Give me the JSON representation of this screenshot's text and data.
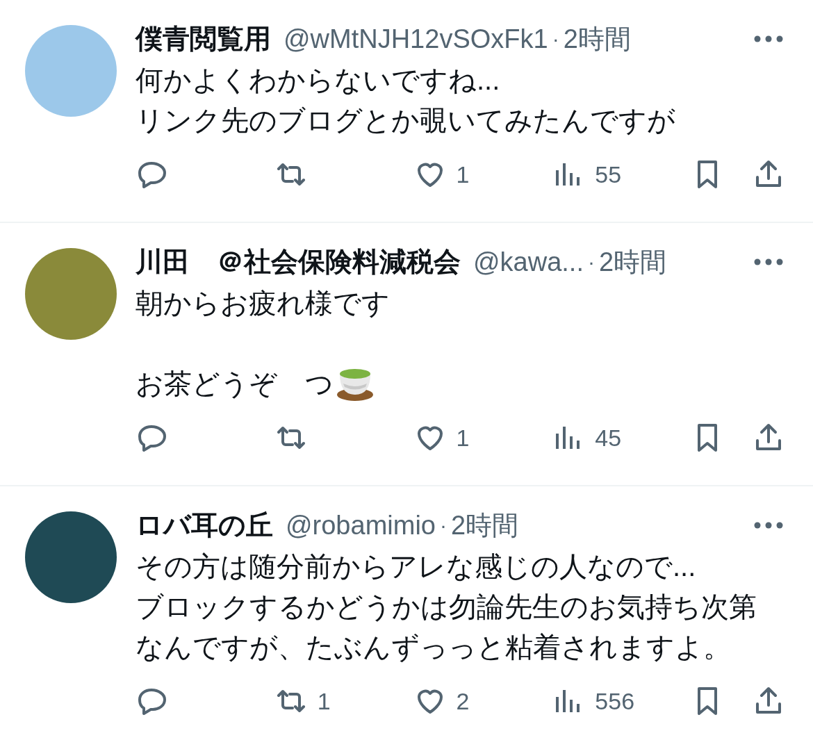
{
  "tweets": [
    {
      "name": "僕青閲覧用",
      "handle": "@wMtNJH12vSOxFk1",
      "separator": "·",
      "time": "2時間",
      "paragraphs": [
        {
          "lines": [
            "何かよくわからないですね...",
            "リンク先のブログとか覗いてみたんですが"
          ]
        }
      ],
      "actions": [
        {
          "kind": "reply"
        },
        {
          "kind": "retweet"
        },
        {
          "kind": "like",
          "count": "1"
        },
        {
          "kind": "views",
          "count": "55"
        },
        {
          "kind": "bookmark"
        },
        {
          "kind": "share"
        }
      ]
    },
    {
      "name": "川田　＠社会保険料減税会",
      "handle": "@kawa...",
      "separator": "·",
      "time": "2時間",
      "paragraphs": [
        {
          "lines": [
            "朝からお疲れ様です"
          ]
        },
        {
          "lines": [
            "お茶どうぞ　つ"
          ],
          "has_emoji": true
        }
      ],
      "actions": [
        {
          "kind": "reply"
        },
        {
          "kind": "retweet"
        },
        {
          "kind": "like",
          "count": "1"
        },
        {
          "kind": "views",
          "count": "45"
        },
        {
          "kind": "bookmark"
        },
        {
          "kind": "share"
        }
      ]
    },
    {
      "name": "ロバ耳の丘",
      "handle": "@robamimio",
      "separator": "·",
      "time": "2時間",
      "paragraphs": [
        {
          "lines": [
            "その方は随分前からアレな感じの人なので...",
            "ブロックするかどうかは勿論先生のお気持ち次第",
            "なんですが、たぶんずっっと粘着されますよ。"
          ]
        }
      ],
      "actions": [
        {
          "kind": "reply"
        },
        {
          "kind": "retweet",
          "count": "1"
        },
        {
          "kind": "like",
          "count": "2"
        },
        {
          "kind": "views",
          "count": "556"
        },
        {
          "kind": "bookmark"
        },
        {
          "kind": "share"
        }
      ]
    }
  ]
}
